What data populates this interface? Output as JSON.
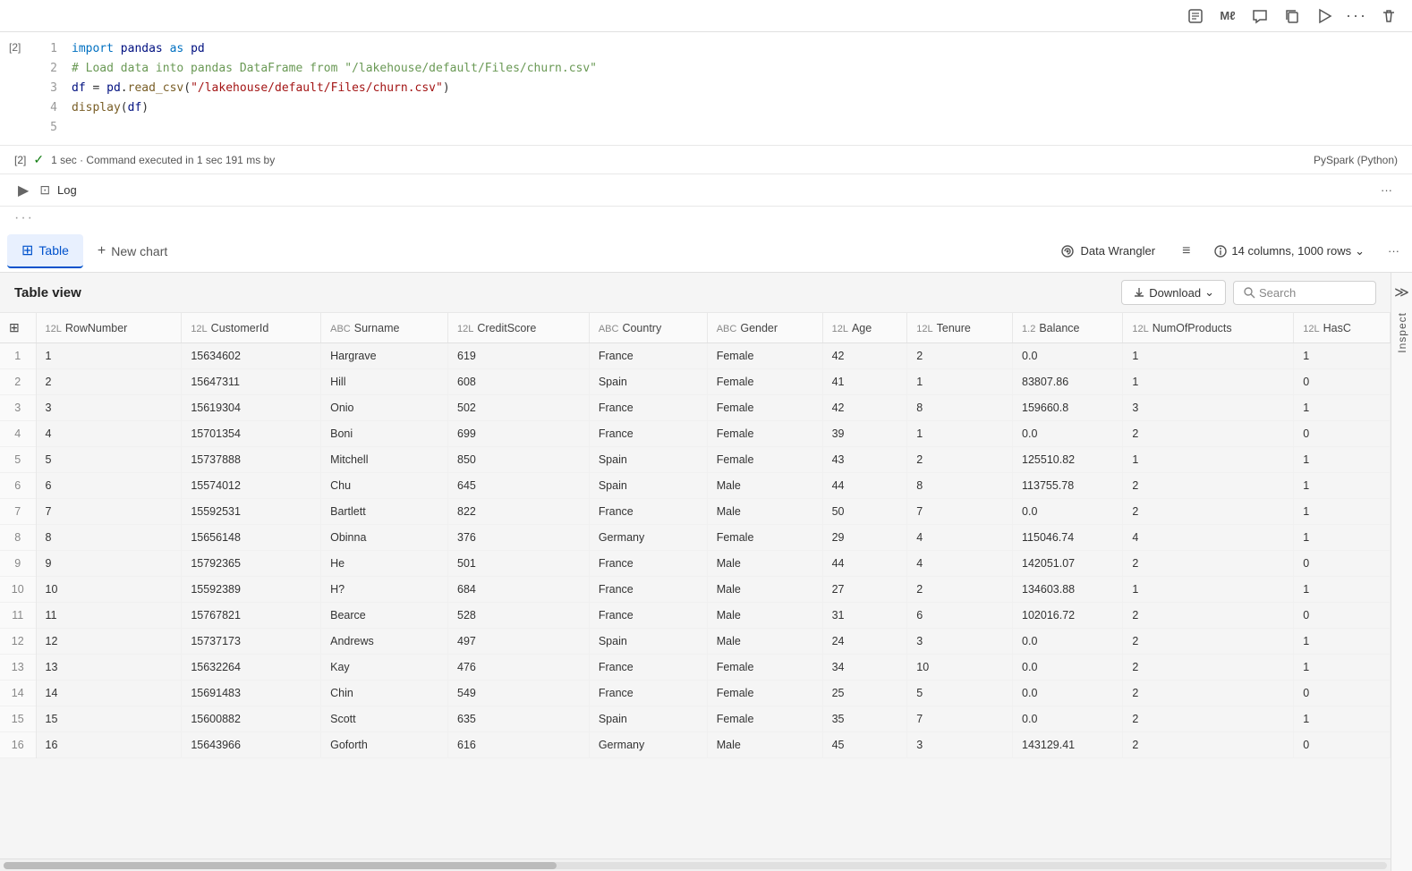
{
  "topToolbar": {
    "icons": [
      "notebook-icon",
      "ml-icon",
      "comment-icon",
      "copy-icon",
      "run-icon",
      "more-icon",
      "delete-icon"
    ]
  },
  "codeCell": {
    "cellNumber": "[2]",
    "lines": [
      {
        "num": 1,
        "text": "import pandas as pd"
      },
      {
        "num": 2,
        "text": "# Load data into pandas DataFrame from \"/lakehouse/default/Files/churn.csv\""
      },
      {
        "num": 3,
        "text": "df = pd.read_csv(\"/lakehouse/default/Files/churn.csv\")"
      },
      {
        "num": 4,
        "text": "display(df)"
      },
      {
        "num": 5,
        "text": ""
      }
    ]
  },
  "execBar": {
    "cellRef": "[2]",
    "status": "✓",
    "timing": "1 sec · Command executed in 1 sec 191 ms by",
    "runtime": "PySpark (Python)"
  },
  "logBar": {
    "expandIcon": "▶",
    "label": "Log",
    "dotsLabel": "···"
  },
  "threeDotsRow": {
    "label": "···"
  },
  "tabs": {
    "items": [
      {
        "id": "table",
        "label": "Table",
        "icon": "⊞",
        "active": true
      },
      {
        "id": "new-chart",
        "label": "New chart",
        "icon": "+",
        "active": false
      }
    ],
    "dataWrangler": "Data Wrangler",
    "filterIcon": "≡",
    "columnsInfo": "14 columns, 1000 rows",
    "chevronDown": "⌄",
    "moreIcon": "···"
  },
  "tableView": {
    "title": "Table view",
    "downloadLabel": "Download",
    "searchPlaceholder": "Search",
    "collapseIcon": "≫"
  },
  "columns": [
    {
      "icon": "⊞",
      "type": "",
      "name": ""
    },
    {
      "icon": "12L",
      "type": "12L",
      "name": "RowNumber"
    },
    {
      "icon": "12L",
      "type": "12L",
      "name": "CustomerId"
    },
    {
      "icon": "ABC",
      "type": "ABC",
      "name": "Surname"
    },
    {
      "icon": "12L",
      "type": "12L",
      "name": "CreditScore"
    },
    {
      "icon": "ABC",
      "type": "ABC",
      "name": "Country"
    },
    {
      "icon": "ABC",
      "type": "ABC",
      "name": "Gender"
    },
    {
      "icon": "12L",
      "type": "12L",
      "name": "Age"
    },
    {
      "icon": "12L",
      "type": "12L",
      "name": "Tenure"
    },
    {
      "icon": "1.2",
      "type": "1.2",
      "name": "Balance"
    },
    {
      "icon": "12L",
      "type": "12L",
      "name": "NumOfProducts"
    },
    {
      "icon": "12L",
      "type": "12L",
      "name": "HasC"
    }
  ],
  "rows": [
    {
      "rn": 1,
      "RowNumber": "1",
      "CustomerId": "15634602",
      "Surname": "Hargrave",
      "CreditScore": "619",
      "Country": "France",
      "Gender": "Female",
      "Age": "42",
      "Tenure": "2",
      "Balance": "0.0",
      "NumOfProducts": "1",
      "HasC": "1"
    },
    {
      "rn": 2,
      "RowNumber": "2",
      "CustomerId": "15647311",
      "Surname": "Hill",
      "CreditScore": "608",
      "Country": "Spain",
      "Gender": "Female",
      "Age": "41",
      "Tenure": "1",
      "Balance": "83807.86",
      "NumOfProducts": "1",
      "HasC": "0"
    },
    {
      "rn": 3,
      "RowNumber": "3",
      "CustomerId": "15619304",
      "Surname": "Onio",
      "CreditScore": "502",
      "Country": "France",
      "Gender": "Female",
      "Age": "42",
      "Tenure": "8",
      "Balance": "159660.8",
      "NumOfProducts": "3",
      "HasC": "1"
    },
    {
      "rn": 4,
      "RowNumber": "4",
      "CustomerId": "15701354",
      "Surname": "Boni",
      "CreditScore": "699",
      "Country": "France",
      "Gender": "Female",
      "Age": "39",
      "Tenure": "1",
      "Balance": "0.0",
      "NumOfProducts": "2",
      "HasC": "0"
    },
    {
      "rn": 5,
      "RowNumber": "5",
      "CustomerId": "15737888",
      "Surname": "Mitchell",
      "CreditScore": "850",
      "Country": "Spain",
      "Gender": "Female",
      "Age": "43",
      "Tenure": "2",
      "Balance": "125510.82",
      "NumOfProducts": "1",
      "HasC": "1"
    },
    {
      "rn": 6,
      "RowNumber": "6",
      "CustomerId": "15574012",
      "Surname": "Chu",
      "CreditScore": "645",
      "Country": "Spain",
      "Gender": "Male",
      "Age": "44",
      "Tenure": "8",
      "Balance": "113755.78",
      "NumOfProducts": "2",
      "HasC": "1"
    },
    {
      "rn": 7,
      "RowNumber": "7",
      "CustomerId": "15592531",
      "Surname": "Bartlett",
      "CreditScore": "822",
      "Country": "France",
      "Gender": "Male",
      "Age": "50",
      "Tenure": "7",
      "Balance": "0.0",
      "NumOfProducts": "2",
      "HasC": "1"
    },
    {
      "rn": 8,
      "RowNumber": "8",
      "CustomerId": "15656148",
      "Surname": "Obinna",
      "CreditScore": "376",
      "Country": "Germany",
      "Gender": "Female",
      "Age": "29",
      "Tenure": "4",
      "Balance": "115046.74",
      "NumOfProducts": "4",
      "HasC": "1"
    },
    {
      "rn": 9,
      "RowNumber": "9",
      "CustomerId": "15792365",
      "Surname": "He",
      "CreditScore": "501",
      "Country": "France",
      "Gender": "Male",
      "Age": "44",
      "Tenure": "4",
      "Balance": "142051.07",
      "NumOfProducts": "2",
      "HasC": "0"
    },
    {
      "rn": 10,
      "RowNumber": "10",
      "CustomerId": "15592389",
      "Surname": "H?",
      "CreditScore": "684",
      "Country": "France",
      "Gender": "Male",
      "Age": "27",
      "Tenure": "2",
      "Balance": "134603.88",
      "NumOfProducts": "1",
      "HasC": "1"
    },
    {
      "rn": 11,
      "RowNumber": "11",
      "CustomerId": "15767821",
      "Surname": "Bearce",
      "CreditScore": "528",
      "Country": "France",
      "Gender": "Male",
      "Age": "31",
      "Tenure": "6",
      "Balance": "102016.72",
      "NumOfProducts": "2",
      "HasC": "0"
    },
    {
      "rn": 12,
      "RowNumber": "12",
      "CustomerId": "15737173",
      "Surname": "Andrews",
      "CreditScore": "497",
      "Country": "Spain",
      "Gender": "Male",
      "Age": "24",
      "Tenure": "3",
      "Balance": "0.0",
      "NumOfProducts": "2",
      "HasC": "1"
    },
    {
      "rn": 13,
      "RowNumber": "13",
      "CustomerId": "15632264",
      "Surname": "Kay",
      "CreditScore": "476",
      "Country": "France",
      "Gender": "Female",
      "Age": "34",
      "Tenure": "10",
      "Balance": "0.0",
      "NumOfProducts": "2",
      "HasC": "1"
    },
    {
      "rn": 14,
      "RowNumber": "14",
      "CustomerId": "15691483",
      "Surname": "Chin",
      "CreditScore": "549",
      "Country": "France",
      "Gender": "Female",
      "Age": "25",
      "Tenure": "5",
      "Balance": "0.0",
      "NumOfProducts": "2",
      "HasC": "0"
    },
    {
      "rn": 15,
      "RowNumber": "15",
      "CustomerId": "15600882",
      "Surname": "Scott",
      "CreditScore": "635",
      "Country": "Spain",
      "Gender": "Female",
      "Age": "35",
      "Tenure": "7",
      "Balance": "0.0",
      "NumOfProducts": "2",
      "HasC": "1"
    },
    {
      "rn": 16,
      "RowNumber": "16",
      "CustomerId": "15643966",
      "Surname": "Goforth",
      "CreditScore": "616",
      "Country": "Germany",
      "Gender": "Male",
      "Age": "45",
      "Tenure": "3",
      "Balance": "143129.41",
      "NumOfProducts": "2",
      "HasC": "0"
    }
  ],
  "inspectLabel": "Inspect"
}
